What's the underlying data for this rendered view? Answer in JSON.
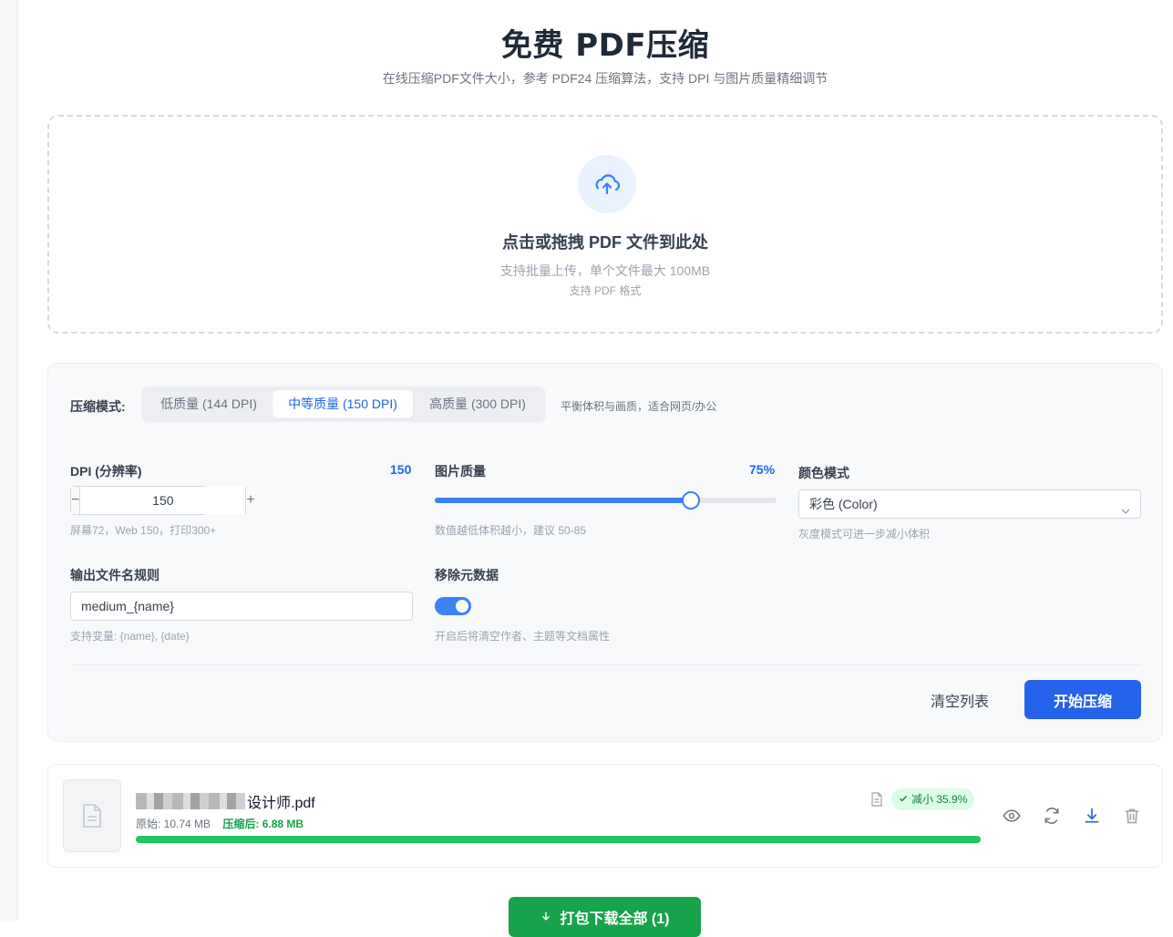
{
  "header": {
    "title": "免费 PDF压缩",
    "subtitle": "在线压缩PDF文件大小，参考 PDF24 压缩算法，支持 DPI 与图片质量精细调节"
  },
  "dropzone": {
    "icon": "upload-cloud-icon",
    "title": "点击或拖拽 PDF 文件到此处",
    "subtitle": "支持批量上传，单个文件最大 100MB",
    "formats": "支持 PDF 格式"
  },
  "settings": {
    "mode_label": "压缩模式:",
    "modes": [
      {
        "label": "低质量 (144 DPI)",
        "active": false
      },
      {
        "label": "中等质量 (150 DPI)",
        "active": true
      },
      {
        "label": "高质量 (300 DPI)",
        "active": false
      }
    ],
    "mode_description": "平衡体积与画质，适合网页/办公",
    "dpi": {
      "label": "DPI (分辨率)",
      "value_display": "150",
      "input_value": "150",
      "decrement": "−",
      "increment": "+",
      "hint": "屏幕72，Web 150，打印300+"
    },
    "image_quality": {
      "label": "图片质量",
      "value_display": "75%",
      "value": 75,
      "hint": "数值越低体积越小，建议 50-85"
    },
    "color_mode": {
      "label": "颜色模式",
      "selected": "彩色 (Color)",
      "hint": "灰度模式可进一步减小体积"
    },
    "filename_rule": {
      "label": "输出文件名规则",
      "value": "medium_{name}",
      "hint": "支持变量: {name}, {date}"
    },
    "remove_metadata": {
      "label": "移除元数据",
      "enabled": true,
      "hint": "开启后将清空作者、主题等文档属性"
    },
    "clear_button": "清空列表",
    "start_button": "开始压缩"
  },
  "files": [
    {
      "name": "设计师.pdf",
      "original_label": "原始: 10.74 MB",
      "compressed_label": "压缩后: 6.88 MB",
      "progress": 1.0,
      "badge": "减小 35.9%",
      "actions": [
        "eye-icon",
        "refresh-icon",
        "download-icon",
        "trash-icon"
      ]
    }
  ],
  "download_all_button": "打包下载全部 (1)",
  "colors": {
    "primary": "#2563eb",
    "success": "#16a34a",
    "accent_blue": "#3b82f6"
  }
}
